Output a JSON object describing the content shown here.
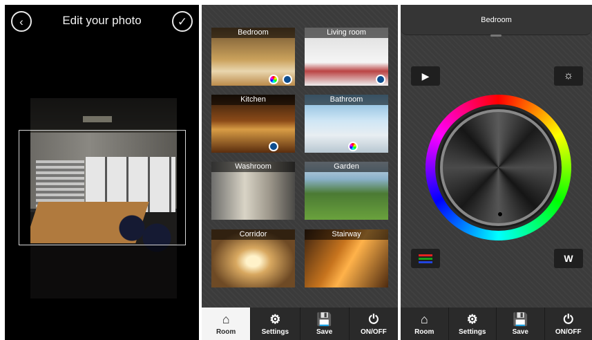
{
  "editor": {
    "title": "Edit your photo",
    "back_icon": "‹",
    "confirm_icon": "✓"
  },
  "rooms": [
    {
      "label": "Bedroom",
      "badges": [
        "color-wheel",
        "blue-dot"
      ]
    },
    {
      "label": "Living room",
      "badges": [
        "blue-dot"
      ]
    },
    {
      "label": "Kitchen",
      "badges": [
        "blue-dot"
      ]
    },
    {
      "label": "Bathroom",
      "badges": [
        "color-wheel"
      ]
    },
    {
      "label": "Washroom",
      "badges": []
    },
    {
      "label": "Garden",
      "badges": []
    },
    {
      "label": "Corridor",
      "badges": []
    },
    {
      "label": "Stairway",
      "badges": []
    }
  ],
  "tabbar": {
    "room": "Room",
    "settings": "Settings",
    "save": "Save",
    "power": "ON/OFF"
  },
  "tab_icons": {
    "room": "⌂",
    "settings": "⚙",
    "save": "💾",
    "power": "⏻"
  },
  "controller": {
    "room_title": "Bedroom",
    "play_icon": "▶",
    "brightness_icon": "☼",
    "white_label": "W"
  },
  "colors": {
    "panel_bg": "#3b3b3b",
    "tab_bg": "#2a2a2a",
    "tab_active_bg": "#f4f4f4",
    "blue_badge": "#0d4d8f"
  }
}
